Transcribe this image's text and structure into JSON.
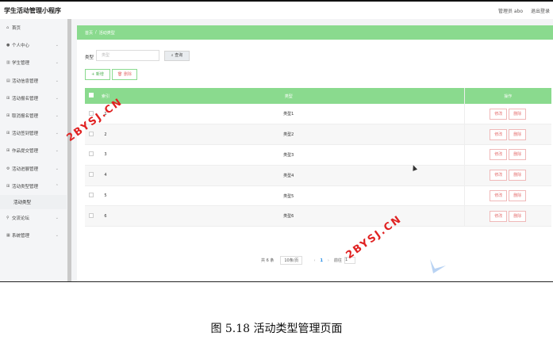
{
  "header": {
    "app_title": "学生活动管理小程序",
    "user_label": "管理员 abo",
    "logout_label": "退出登录"
  },
  "sidebar": {
    "items": [
      {
        "label": "首页",
        "icon": "home-icon",
        "chevron": false
      },
      {
        "label": "个人中心",
        "icon": "user-icon",
        "chevron": true
      },
      {
        "label": "学生管理",
        "icon": "building-icon",
        "chevron": true
      },
      {
        "label": "活动信息管理",
        "icon": "list-icon",
        "chevron": true
      },
      {
        "label": "活动报名管理",
        "icon": "grid-icon",
        "chevron": true
      },
      {
        "label": "取消报名管理",
        "icon": "grid-icon",
        "chevron": true
      },
      {
        "label": "活动签到管理",
        "icon": "grid-icon",
        "chevron": true
      },
      {
        "label": "作品提交管理",
        "icon": "grid-icon",
        "chevron": true
      },
      {
        "label": "活动进展管理",
        "icon": "gear-icon",
        "chevron": true
      },
      {
        "label": "活动类型管理",
        "icon": "grid-icon",
        "chevron": true
      },
      {
        "label": "交流论坛",
        "icon": "pin-icon",
        "chevron": true
      },
      {
        "label": "系统管理",
        "icon": "chart-icon",
        "chevron": true
      }
    ],
    "sub_item": "活动类型"
  },
  "breadcrumb": {
    "home": "首页",
    "separator": "/",
    "current": "活动类型"
  },
  "search": {
    "label": "类型",
    "placeholder": "类型",
    "query_button": "查询"
  },
  "toolbar": {
    "add_button": "新增",
    "delete_button": "删除"
  },
  "table": {
    "headers": {
      "index": "索引",
      "type": "类型",
      "actions": "操作"
    },
    "rows": [
      {
        "index": "1",
        "type": "类型1"
      },
      {
        "index": "2",
        "type": "类型2"
      },
      {
        "index": "3",
        "type": "类型3"
      },
      {
        "index": "4",
        "type": "类型4"
      },
      {
        "index": "5",
        "type": "类型5"
      },
      {
        "index": "6",
        "type": "类型6"
      }
    ],
    "edit_label": "修改",
    "delete_label": "删除"
  },
  "pagination": {
    "total": "共 6 条",
    "page_size": "10条/页",
    "prev": "‹",
    "page": "1",
    "next": "›",
    "goto_label": "前往",
    "goto_value": "1"
  },
  "watermark": "2BYSJ.CN",
  "caption": "图 5.18 活动类型管理页面",
  "colors": {
    "accent": "#8ada8e",
    "danger": "#e57373",
    "watermark": "#e02222"
  }
}
